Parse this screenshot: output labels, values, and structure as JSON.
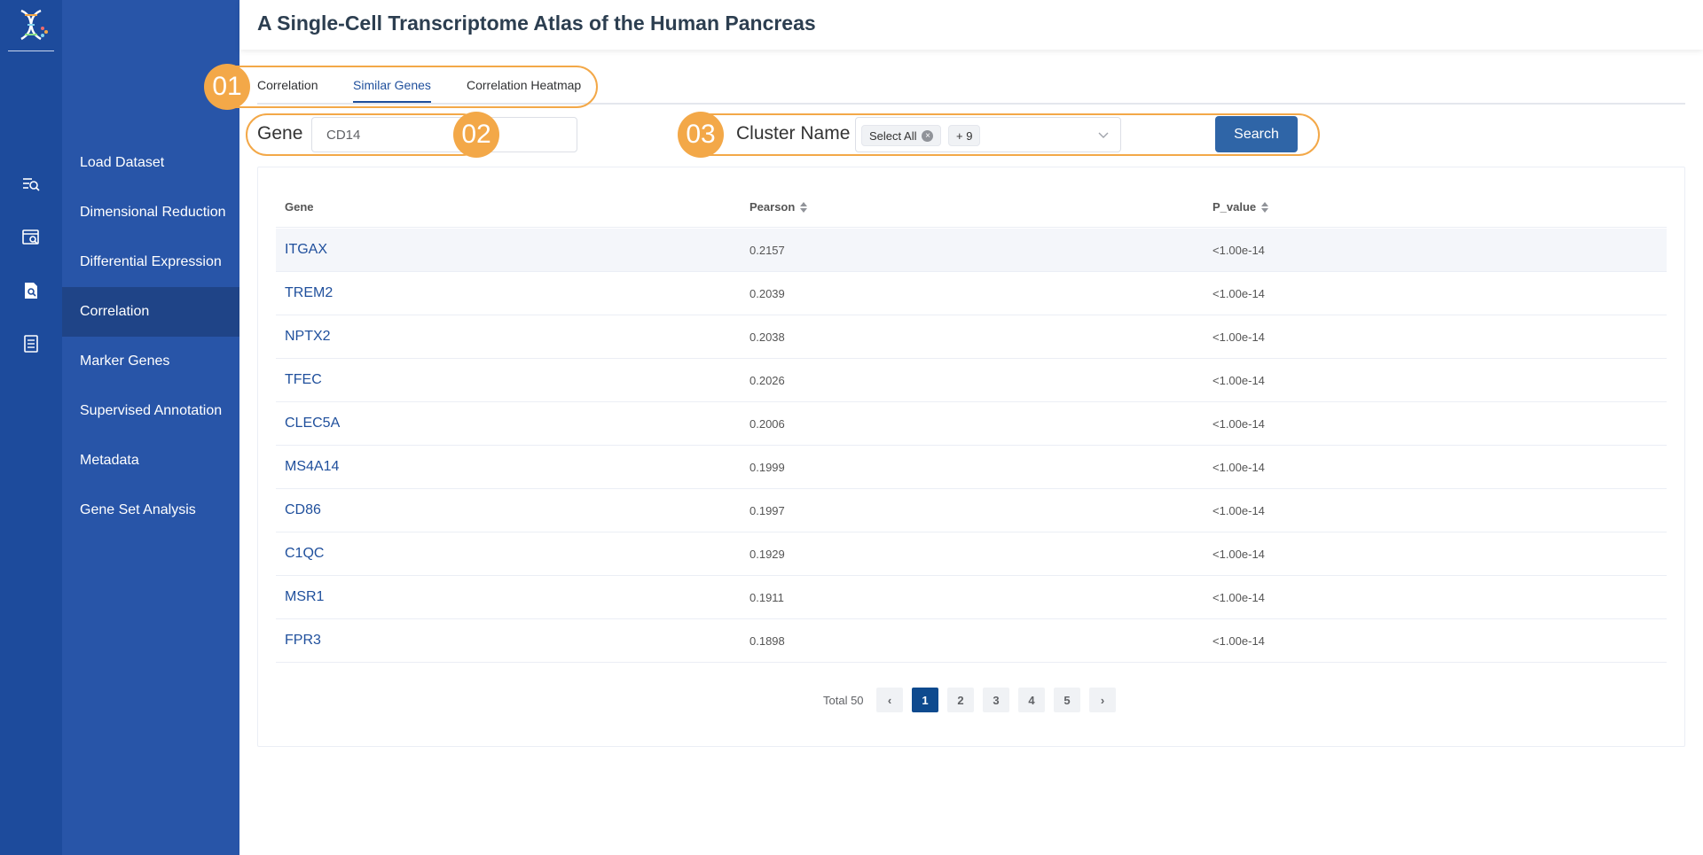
{
  "header": {
    "title": "A Single-Cell Transcriptome Atlas of the Human Pancreas"
  },
  "rail": {
    "icons": [
      "dna-logo-icon",
      "search-list-icon",
      "browse-data-icon",
      "document-search-icon",
      "notebook-icon"
    ]
  },
  "menu": {
    "items": [
      {
        "label": "Load Dataset",
        "active": false
      },
      {
        "label": "Dimensional Reduction",
        "active": false
      },
      {
        "label": "Differential Expression",
        "active": false
      },
      {
        "label": "Correlation",
        "active": true
      },
      {
        "label": "Marker Genes",
        "active": false
      },
      {
        "label": "Supervised Annotation",
        "active": false
      },
      {
        "label": "Metadata",
        "active": false
      },
      {
        "label": "Gene Set Analysis",
        "active": false
      }
    ]
  },
  "tabs": [
    {
      "label": "Correlation",
      "active": false
    },
    {
      "label": "Similar Genes",
      "active": true
    },
    {
      "label": "Correlation Heatmap",
      "active": false
    }
  ],
  "callouts": [
    "01",
    "02",
    "03"
  ],
  "form": {
    "gene_label": "Gene",
    "gene_value": "CD14",
    "cluster_label": "Cluster Name",
    "cluster_tags": [
      "Select All",
      "+ 9"
    ],
    "search_label": "Search"
  },
  "table": {
    "columns": [
      "Gene",
      "Pearson",
      "P_value"
    ],
    "rows": [
      {
        "gene": "ITGAX",
        "pearson": "0.2157",
        "p": "<1.00e-14"
      },
      {
        "gene": "TREM2",
        "pearson": "0.2039",
        "p": "<1.00e-14"
      },
      {
        "gene": "NPTX2",
        "pearson": "0.2038",
        "p": "<1.00e-14"
      },
      {
        "gene": "TFEC",
        "pearson": "0.2026",
        "p": "<1.00e-14"
      },
      {
        "gene": "CLEC5A",
        "pearson": "0.2006",
        "p": "<1.00e-14"
      },
      {
        "gene": "MS4A14",
        "pearson": "0.1999",
        "p": "<1.00e-14"
      },
      {
        "gene": "CD86",
        "pearson": "0.1997",
        "p": "<1.00e-14"
      },
      {
        "gene": "C1QC",
        "pearson": "0.1929",
        "p": "<1.00e-14"
      },
      {
        "gene": "MSR1",
        "pearson": "0.1911",
        "p": "<1.00e-14"
      },
      {
        "gene": "FPR3",
        "pearson": "0.1898",
        "p": "<1.00e-14"
      }
    ]
  },
  "pagination": {
    "total": "Total 50",
    "pages": [
      "1",
      "2",
      "3",
      "4",
      "5"
    ],
    "current": "1",
    "prev": "‹",
    "next": "›"
  },
  "colors": {
    "rail": "#1d4b9c",
    "menu": "#2855a8",
    "menu_active": "#1f4487",
    "accent": "#1f4f9c",
    "callout": "#f3a848",
    "button": "#2f65a7"
  }
}
